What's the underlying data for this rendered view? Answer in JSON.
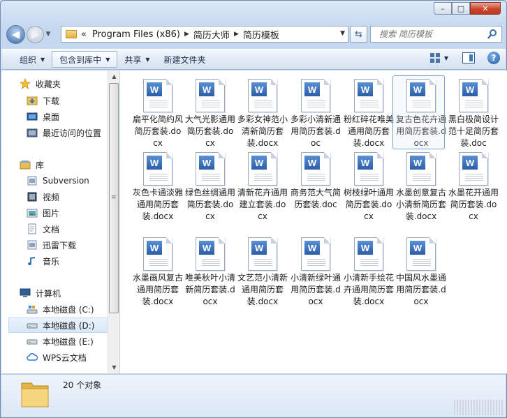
{
  "window": {
    "close_label": "✕",
    "max_label": "□",
    "min_label": "–"
  },
  "nav": {
    "back_label": "◀",
    "forward_label": "▶"
  },
  "address": {
    "prefix": "«",
    "crumbs": [
      "Program Files (x86)",
      "简历大师",
      "简历模板"
    ]
  },
  "search": {
    "placeholder": "搜索 简历模板"
  },
  "toolbar": {
    "organize": "组织",
    "include_library": "包含到库中",
    "share": "共享",
    "new_folder": "新建文件夹"
  },
  "sidebar": {
    "favorites": "收藏夹",
    "downloads": "下载",
    "desktop": "桌面",
    "recent": "最近访问的位置",
    "libraries": "库",
    "subversion": "Subversion",
    "videos": "视频",
    "pictures": "图片",
    "documents": "文档",
    "thunder": "迅雷下载",
    "music": "音乐",
    "computer": "计算机",
    "disk_c": "本地磁盘 (C:)",
    "disk_d": "本地磁盘 (D:)",
    "disk_e": "本地磁盘 (E:)",
    "wps": "WPS云文档"
  },
  "files": [
    {
      "name": "扁平化简约风简历套装.docx"
    },
    {
      "name": "大气光影通用简历套装.docx"
    },
    {
      "name": "多彩女神范小清新简历套装.docx"
    },
    {
      "name": "多彩小清新通用简历套装.doc"
    },
    {
      "name": "粉红碎花唯美通用简历套装.docx"
    },
    {
      "name": "复古色花卉通用简历套装.docx"
    },
    {
      "name": "黑白极简设计范十足简历套装.doc"
    },
    {
      "name": "灰色卡通淡雅通用简历套装.docx"
    },
    {
      "name": "绿色丝绸通用简历套装.docx"
    },
    {
      "name": "清新花卉通用建立套装.docx"
    },
    {
      "name": "商务范大气简历套装.doc"
    },
    {
      "name": "树枝绿叶通用简历套装.docx"
    },
    {
      "name": "水墨创意复古小清新简历套装.docx"
    },
    {
      "name": "水墨花开通用简历套装.docx"
    },
    {
      "name": "水墨画风复古通用简历套装.docx"
    },
    {
      "name": "唯美秋叶小清新简历套装.docx"
    },
    {
      "name": "文艺范小清新通用简历套装.docx"
    },
    {
      "name": "小清新绿叶通用简历套装.docx"
    },
    {
      "name": "小清新手绘花卉通用简历套装.docx"
    },
    {
      "name": "中国风水墨通用简历套装.docx"
    }
  ],
  "file_icon_letter": "W",
  "details": {
    "count": "20 个对象"
  },
  "colors": {
    "accent": "#2a5ea9",
    "selection": "#d9e7f8"
  }
}
